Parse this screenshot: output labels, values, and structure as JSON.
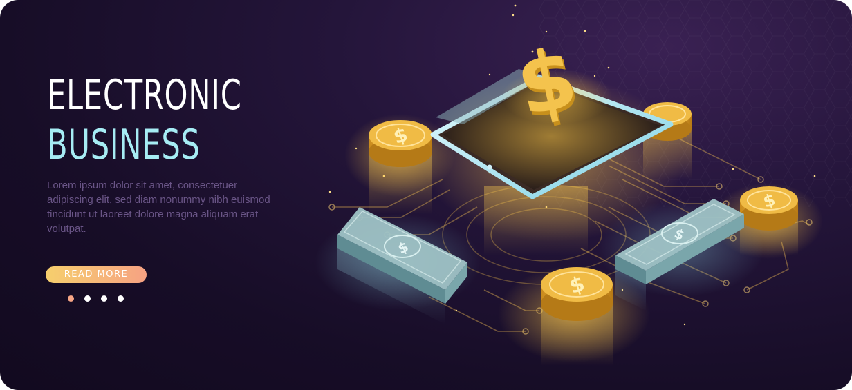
{
  "hero": {
    "title_line1": "ELECTRONIC",
    "title_line2": "BUSINESS",
    "description": "Lorem ipsum dolor sit amet, consectetuer adipiscing elit, sed diam nonummy nibh euismod tincidunt ut laoreet dolore magna aliquam erat volutpat.",
    "read_more_label": "READ MORE"
  },
  "carousel": {
    "slide_count": 4,
    "active_index": 0
  },
  "illustration": {
    "coin_glyph": "$",
    "banknote_glyph": "$",
    "icons": [
      "tablet-icon",
      "dollar-sign-icon",
      "coin-stack-icon",
      "banknote-stack-icon",
      "circuit-lines"
    ]
  },
  "colors": {
    "background": "#1b1029",
    "title_white": "#ffffff",
    "title_cyan": "#a6ecf4",
    "description": "#6a5587",
    "gold": "#f2c14e",
    "button_gradient_start": "#f6cf6d",
    "button_gradient_end": "#f6a283",
    "dot_active": "#f7a686",
    "dot_inactive": "#ffffff"
  }
}
